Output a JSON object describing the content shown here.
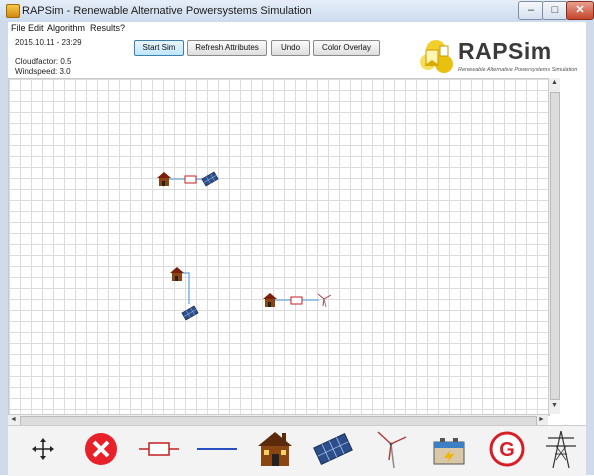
{
  "window": {
    "title": "RAPSim - Renewable Alternative Powersystems Simulation",
    "min_glyph": "–",
    "max_glyph": "□",
    "close_glyph": "✕"
  },
  "menu": [
    "File",
    "Edit",
    "Algorithm",
    "Results",
    "?"
  ],
  "status": {
    "datetime": "2015.10.11 - 23:29",
    "cloudfactor": "Cloudfactor: 0.5",
    "windspeed": "Windspeed: 3.0"
  },
  "buttons": {
    "start_sim": "Start Sim",
    "refresh": "Refresh Attributes",
    "undo": "Undo",
    "overlay": "Color Overlay"
  },
  "logo": {
    "name": "RAPSim",
    "subtitle": "Renewable Alternative Powersystems Simulation"
  },
  "scrollbar": {
    "up": "▲",
    "down": "▼",
    "left": "◄",
    "right": "►"
  },
  "toolbar_items": [
    "move-icon",
    "delete-icon",
    "resistor-icon",
    "line-icon",
    "house-icon",
    "solar-panel-icon",
    "wind-turbine-icon",
    "battery-icon",
    "generator-icon",
    "transmission-tower-icon"
  ],
  "colors": {
    "accent": "#3c7fb1",
    "cable": "#7fb3e0",
    "delete": "#e8202a",
    "generator": "#d61f26"
  }
}
